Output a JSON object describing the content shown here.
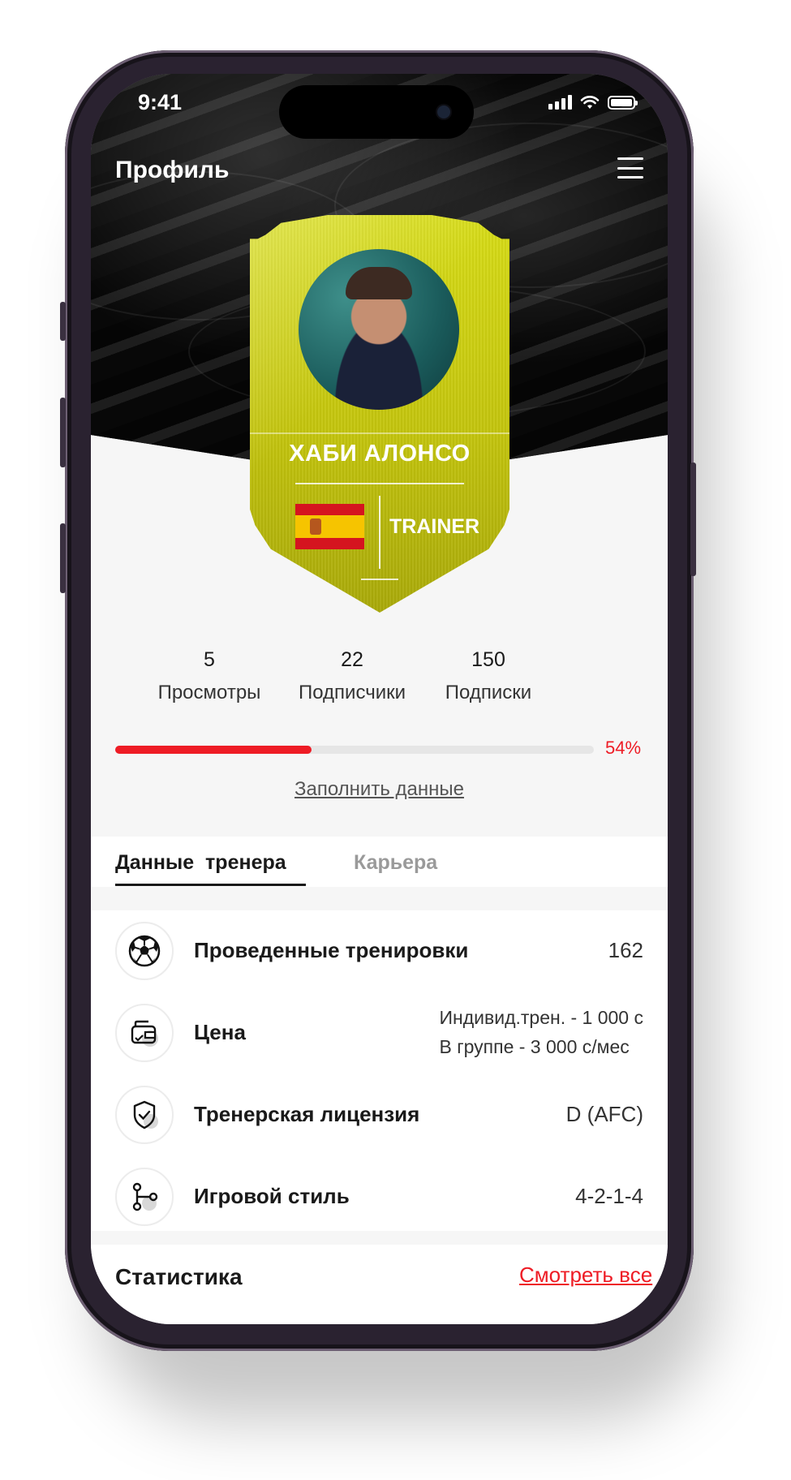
{
  "status_bar": {
    "time": "9:41"
  },
  "header": {
    "title": "Профиль"
  },
  "player_card": {
    "name": "ХАБИ АЛОНСО",
    "role": "TRAINER",
    "country_flag": "Spain"
  },
  "stats": [
    {
      "value": "5",
      "label": "Просмотры"
    },
    {
      "value": "22",
      "label": "Подписчики"
    },
    {
      "value": "150",
      "label": "Подписки"
    }
  ],
  "profile_progress": {
    "percent_label": "54%",
    "fraction": 0.54
  },
  "fill_data_link": "Заполнить данные",
  "tabs": [
    {
      "label": "Данные  тренера",
      "active": true
    },
    {
      "label": "Карьера",
      "active": false
    }
  ],
  "details": [
    {
      "icon": "soccer-ball-icon",
      "label": "Проведенные тренировки",
      "value": "162"
    },
    {
      "icon": "wallet-icon",
      "label": "Цена",
      "value_lines": [
        "Индивид.трен. - 1 000 с",
        "В группе - 3 000 с/мес"
      ]
    },
    {
      "icon": "shield-check-icon",
      "label": "Тренерская лицензия",
      "value": "D (AFC)"
    },
    {
      "icon": "git-branch-icon",
      "label": "Игровой стиль",
      "value": "4-2-1-4"
    }
  ],
  "statistics_section": {
    "title": "Статистика",
    "see_all": "Смотреть все"
  },
  "colors": {
    "accent": "#ee1c25",
    "card_gold": "#c8c90f",
    "hero_bg": "#000000"
  }
}
